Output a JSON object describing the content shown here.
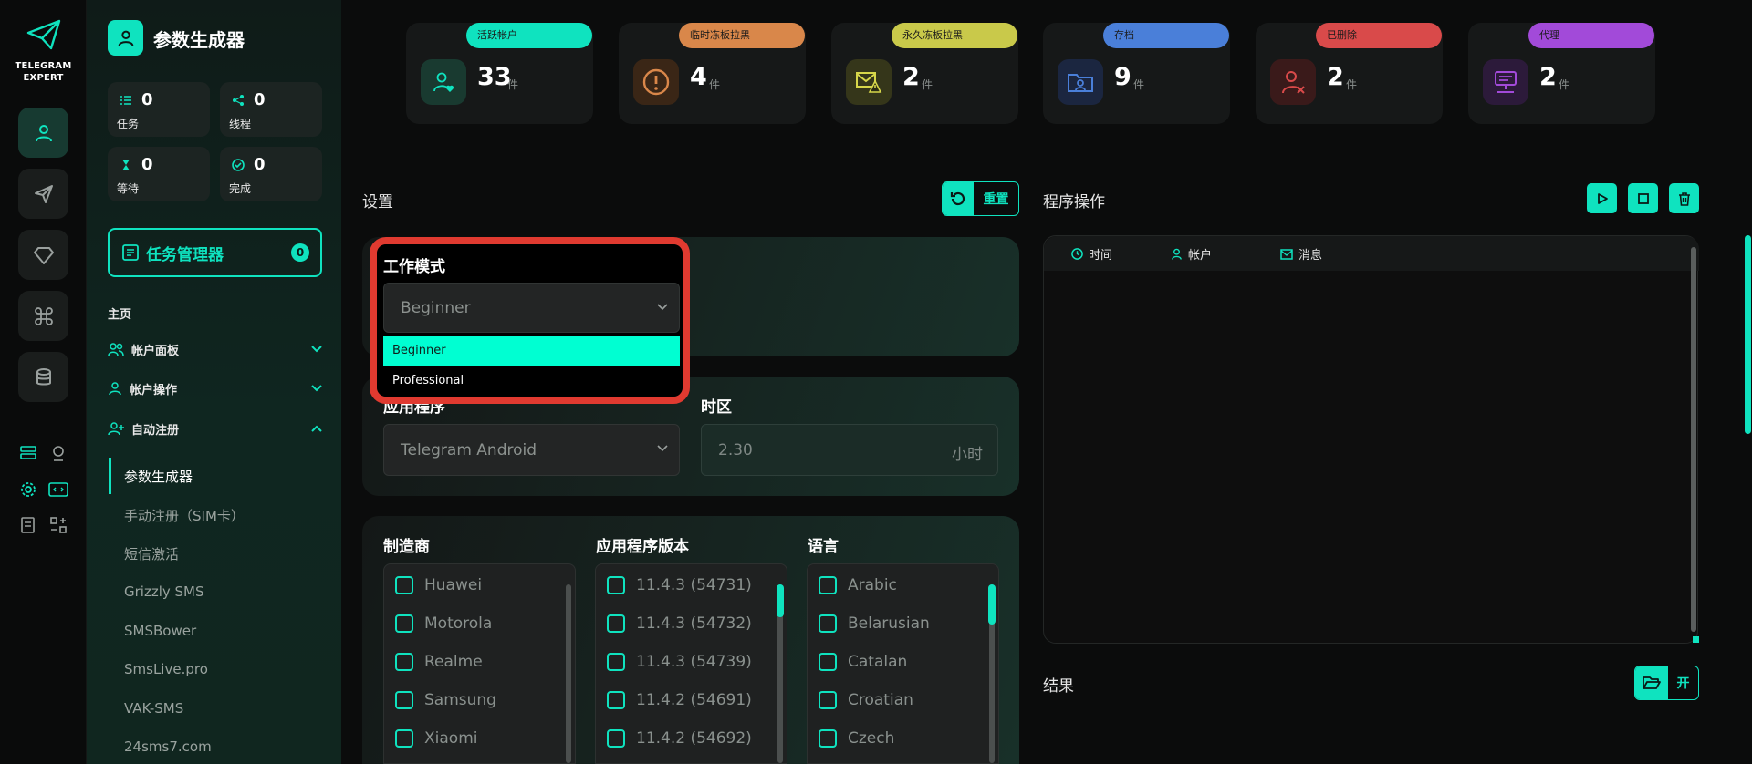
{
  "colors": {
    "accent": "#0fe3bf",
    "danger_outline": "#e03a30",
    "background": "#0b0c0c"
  },
  "rail": {
    "logo_line1": "TELEGRAM",
    "logo_line2": "EXPERT",
    "nav_icons": [
      "user-icon",
      "send-icon",
      "diamond-icon",
      "command-icon",
      "database-icon"
    ],
    "tool_icons": [
      "server-list-icon",
      "webcam-icon",
      "gear-icon",
      "code-window-icon",
      "checklist-icon",
      "grid-icon"
    ]
  },
  "sidebar": {
    "title": "参数生成器",
    "stats": [
      {
        "label": "任务",
        "value": "0",
        "icon": "list-icon"
      },
      {
        "label": "线程",
        "value": "0",
        "icon": "share-icon"
      },
      {
        "label": "等待",
        "value": "0",
        "icon": "hourglass-icon"
      },
      {
        "label": "完成",
        "value": "0",
        "icon": "check-circle-icon"
      }
    ],
    "task_manager": {
      "label": "任务管理器",
      "count": "0"
    },
    "home_heading": "主页",
    "groups": [
      {
        "label": "帐户面板",
        "expanded": false
      },
      {
        "label": "帐户操作",
        "expanded": false
      },
      {
        "label": "自动注册",
        "expanded": true
      }
    ],
    "sub_items": [
      "参数生成器",
      "手动注册（SIM卡）",
      "短信激活",
      "Grizzly SMS",
      "SMSBower",
      "SmsLive.pro",
      "VAK-SMS",
      "24sms7.com"
    ],
    "active_sub": "参数生成器"
  },
  "top_stats": [
    {
      "label": "活跃帐户",
      "value": "33",
      "unit": "件",
      "color": "#0fe3bf",
      "icon": "user-heart-icon"
    },
    {
      "label": "临时冻板拉黑",
      "value": "4",
      "unit": "件",
      "color": "#d9874a",
      "icon": "warning-circle-icon"
    },
    {
      "label": "永久冻板拉黑",
      "value": "2",
      "unit": "件",
      "color": "#c9c94a",
      "icon": "mail-warning-icon"
    },
    {
      "label": "存档",
      "value": "9",
      "unit": "件",
      "color": "#4a7fd9",
      "icon": "folder-user-icon"
    },
    {
      "label": "已删除",
      "value": "2",
      "unit": "件",
      "color": "#d94a4a",
      "icon": "user-x-icon"
    },
    {
      "label": "代理",
      "value": "2",
      "unit": "件",
      "color": "#a24ad9",
      "icon": "server-proxy-icon"
    }
  ],
  "settings": {
    "title": "设置",
    "reset_label": "重置",
    "work_mode": {
      "label": "工作模式",
      "value": "Beginner",
      "options": [
        "Beginner",
        "Professional"
      ],
      "highlighted": "Beginner"
    },
    "app": {
      "label": "应用程序",
      "value": "Telegram Android"
    },
    "timezone": {
      "label": "时区",
      "value": "2.30",
      "unit": "小时"
    },
    "manufacturer": {
      "label": "制造商",
      "items": [
        "Huawei",
        "Motorola",
        "Realme",
        "Samsung",
        "Xiaomi"
      ]
    },
    "app_version": {
      "label": "应用程序版本",
      "items": [
        "11.4.3 (54731)",
        "11.4.3 (54732)",
        "11.4.3 (54739)",
        "11.4.2 (54691)",
        "11.4.2 (54692)"
      ]
    },
    "language": {
      "label": "语言",
      "items": [
        "Arabic",
        "Belarusian",
        "Catalan",
        "Croatian",
        "Czech"
      ]
    }
  },
  "operations": {
    "title": "程序操作",
    "buttons": [
      "play-icon",
      "stop-icon",
      "trash-icon"
    ],
    "log_columns": [
      {
        "label": "时间",
        "icon": "clock-icon"
      },
      {
        "label": "帐户",
        "icon": "user-icon"
      },
      {
        "label": "消息",
        "icon": "mail-icon"
      }
    ]
  },
  "results": {
    "title": "结果",
    "open_label": "开"
  }
}
